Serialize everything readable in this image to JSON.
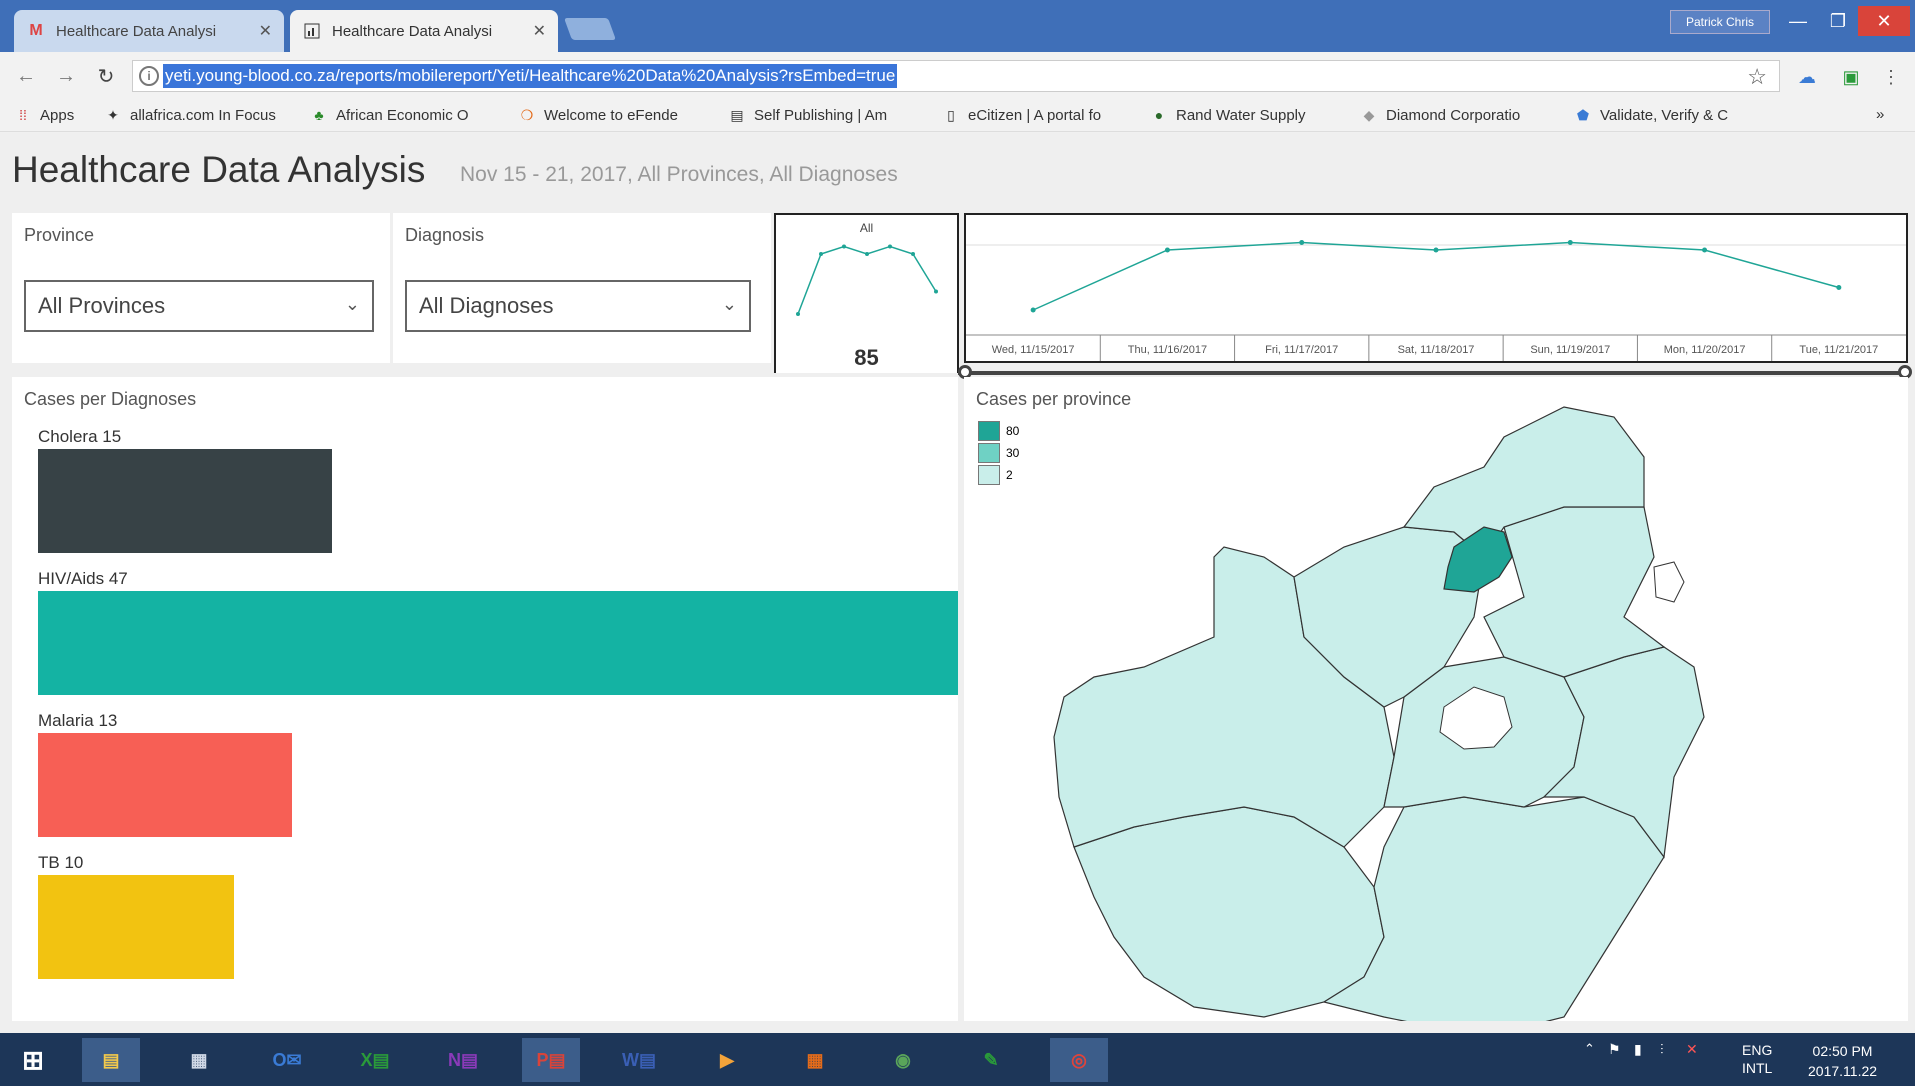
{
  "browser": {
    "tabs": [
      {
        "title": "Healthcare Data Analysi",
        "icon": "gmail-icon",
        "active": false
      },
      {
        "title": "Healthcare Data Analysi",
        "icon": "report-icon",
        "active": true
      }
    ],
    "profile_name": "Patrick Chris",
    "url": "yeti.young-blood.co.za/reports/mobilereport/Yeti/Healthcare%20Data%20Analysis?rsEmbed=true",
    "bookmarks": [
      {
        "label": "Apps",
        "icon": "apps-grid-icon"
      },
      {
        "label": "allafrica.com In Focus",
        "icon": "allafrica-icon"
      },
      {
        "label": "African Economic O",
        "icon": "africa-icon"
      },
      {
        "label": "Welcome to eFende",
        "icon": "efende-icon"
      },
      {
        "label": "Self Publishing | Am",
        "icon": "publishing-icon"
      },
      {
        "label": "eCitizen | A portal fo",
        "icon": "document-icon"
      },
      {
        "label": "Rand Water Supply",
        "icon": "water-icon"
      },
      {
        "label": "Diamond Corporatio",
        "icon": "diamond-icon"
      },
      {
        "label": "Validate, Verify & C",
        "icon": "shield-icon"
      }
    ],
    "bookmarks_more": "»"
  },
  "report": {
    "title": "Healthcare Data Analysis",
    "subtitle": "Nov 15 - 21, 2017, All Provinces, All Diagnoses",
    "province_filter": {
      "label": "Province",
      "value": "All Provinces"
    },
    "diagnosis_filter": {
      "label": "Diagnosis",
      "value": "All Diagnoses"
    },
    "kpi": {
      "title": "All",
      "value": "85",
      "sparkline": [
        2,
        10,
        11,
        10,
        11,
        10,
        5
      ]
    },
    "timeline": {
      "dates": [
        "Wed, 11/15/2017",
        "Thu, 11/16/2017",
        "Fri, 11/17/2017",
        "Sat, 11/18/2017",
        "Sun, 11/19/2017",
        "Mon, 11/20/2017",
        "Tue, 11/21/2017"
      ]
    },
    "cases_per_diagnosis": {
      "title": "Cases per Diagnoses"
    },
    "cases_per_province": {
      "title": "Cases per province",
      "legend": [
        {
          "label": "80",
          "color": "#1fa596"
        },
        {
          "label": "30",
          "color": "#6fd1c4"
        },
        {
          "label": "2",
          "color": "#c9eeea"
        }
      ]
    }
  },
  "chart_data": [
    {
      "type": "bar",
      "title": "Cases per Diagnoses",
      "categories": [
        "Cholera",
        "HIV/Aids",
        "Malaria",
        "TB"
      ],
      "values": [
        15,
        47,
        13,
        10
      ],
      "colors": [
        "#374246",
        "#14b3a3",
        "#f75f55",
        "#f2c311"
      ]
    },
    {
      "type": "line",
      "x": [
        "Wed, 11/15/2017",
        "Thu, 11/16/2017",
        "Fri, 11/17/2017",
        "Sat, 11/18/2017",
        "Sun, 11/19/2017",
        "Mon, 11/20/2017",
        "Tue, 11/21/2017"
      ],
      "series": [
        {
          "values": [
            2,
            10,
            11,
            10,
            11,
            10,
            5
          ]
        }
      ]
    }
  ],
  "taskbar": {
    "apps": [
      {
        "icon": "file-explorer-icon",
        "active": true
      },
      {
        "icon": "calculator-icon",
        "active": false
      },
      {
        "icon": "outlook-icon",
        "active": false
      },
      {
        "icon": "excel-icon",
        "active": false
      },
      {
        "icon": "onenote-icon",
        "active": false
      },
      {
        "icon": "powerpoint-icon",
        "active": true
      },
      {
        "icon": "word-icon",
        "active": false
      },
      {
        "icon": "media-player-icon",
        "active": false
      },
      {
        "icon": "app-grid-icon",
        "active": false
      },
      {
        "icon": "globe-icon",
        "active": false
      },
      {
        "icon": "evernote-icon",
        "active": false
      },
      {
        "icon": "chrome-icon",
        "active": true
      }
    ],
    "lang": "ENG",
    "lang2": "INTL",
    "time": "02:50 PM",
    "date": "2017.11.22"
  }
}
